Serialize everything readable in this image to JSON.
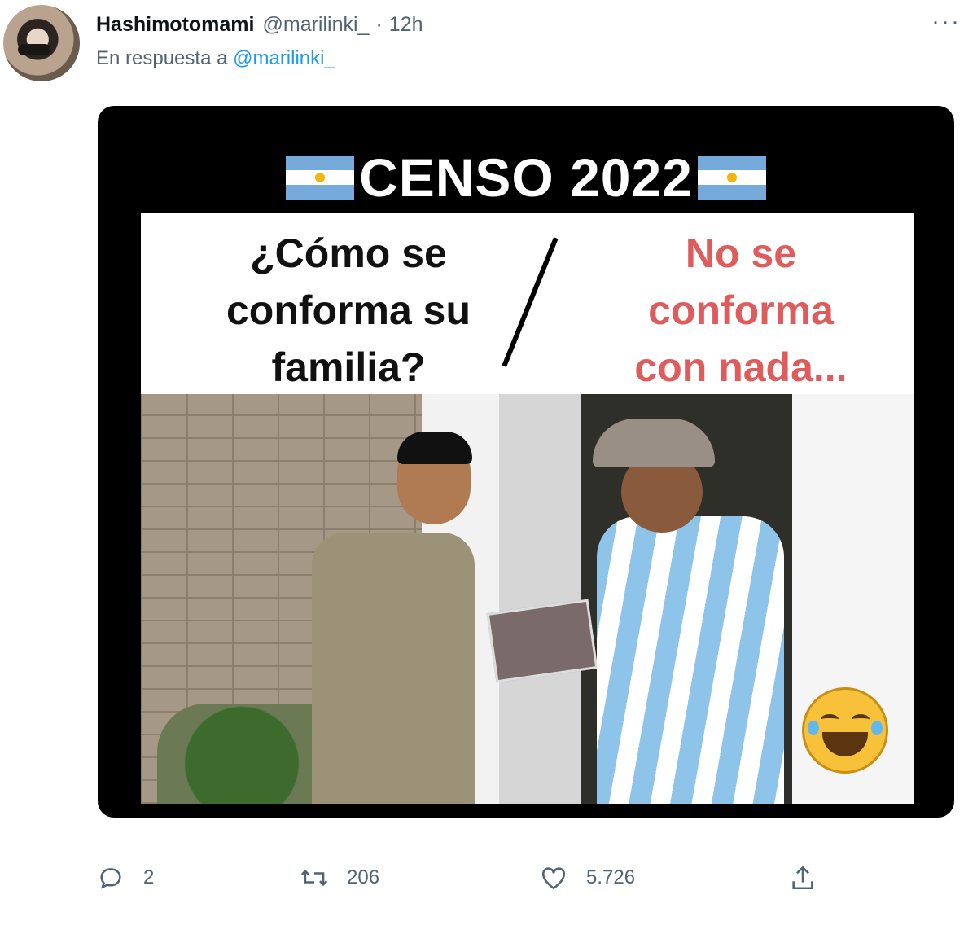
{
  "tweet": {
    "display_name": "Hashimotomami",
    "handle": "@marilinki_",
    "separator": "·",
    "time": "12h",
    "more_label": "···",
    "reply_prefix": "En respuesta a",
    "reply_mention": "@marilinki_"
  },
  "media": {
    "title": "CENSO 2022",
    "left_text": "¿Cómo se conforma su familia?",
    "right_text": "No se conforma con nada...",
    "right_text_color": "#e05c5c",
    "flag_colors": [
      "#75aadb",
      "#ffffff",
      "#f6b40e"
    ]
  },
  "actions": {
    "reply_count": "2",
    "retweet_count": "206",
    "like_count": "5.726"
  },
  "icons": [
    "reply-icon",
    "retweet-icon",
    "like-icon",
    "share-icon",
    "more-icon"
  ]
}
